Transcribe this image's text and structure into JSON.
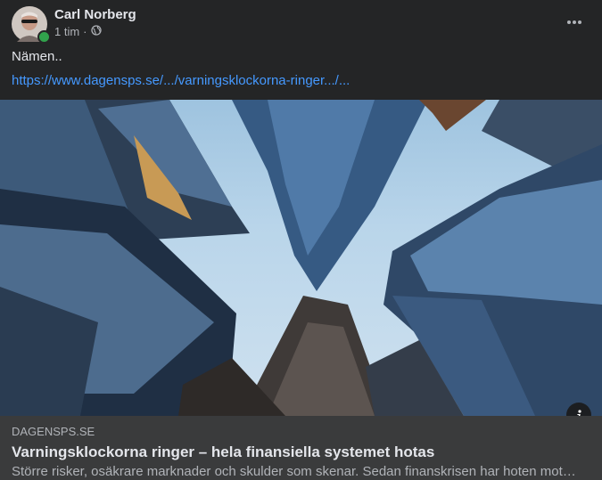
{
  "post": {
    "author": "Carl Norberg",
    "time": "1 tim",
    "separator": "·",
    "audience_icon": "globe-icon",
    "text": "Nämen..",
    "link_text": "https://www.dagensps.se/.../varningsklockorna-ringer.../..."
  },
  "link_preview": {
    "domain": "DAGENSPS.SE",
    "title": "Varningsklockorna ringer – hela finansiella systemet hotas",
    "description": "Större risker, osäkrare marknader och skulder som skenar. Sedan finanskrisen har hoten mot…"
  },
  "colors": {
    "background": "#242526",
    "card": "#3a3b3c",
    "link": "#4599ff",
    "online": "#31a24c"
  }
}
